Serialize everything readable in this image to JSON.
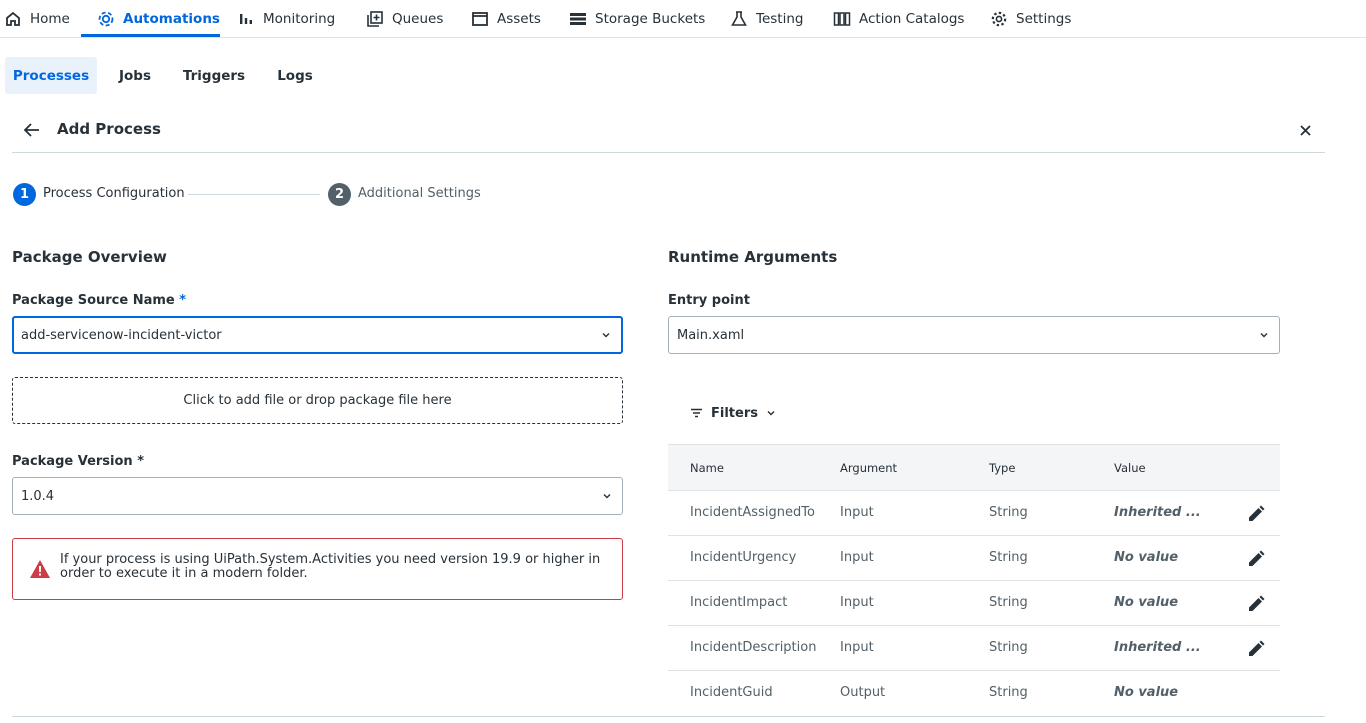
{
  "nav": {
    "items": [
      {
        "label": "Home",
        "icon": "home-icon"
      },
      {
        "label": "Automations",
        "icon": "automations-icon",
        "active": true
      },
      {
        "label": "Monitoring",
        "icon": "monitoring-icon"
      },
      {
        "label": "Queues",
        "icon": "queues-icon"
      },
      {
        "label": "Assets",
        "icon": "assets-icon"
      },
      {
        "label": "Storage Buckets",
        "icon": "storage-buckets-icon"
      },
      {
        "label": "Testing",
        "icon": "testing-icon"
      },
      {
        "label": "Action Catalogs",
        "icon": "action-catalogs-icon"
      },
      {
        "label": "Settings",
        "icon": "settings-icon"
      }
    ]
  },
  "subtabs": [
    {
      "label": "Processes",
      "active": true
    },
    {
      "label": "Jobs"
    },
    {
      "label": "Triggers"
    },
    {
      "label": "Logs"
    }
  ],
  "header": {
    "title": "Add Process"
  },
  "stepper": {
    "step1": {
      "number": "1",
      "label": "Process Configuration"
    },
    "step2": {
      "number": "2",
      "label": "Additional Settings"
    }
  },
  "package": {
    "section_title": "Package Overview",
    "source_label": "Package Source Name",
    "required_mark": "*",
    "source_value": "add-servicenow-incident-victor",
    "dropzone_text": "Click to add file or drop package file here",
    "version_label": "Package Version *",
    "version_value": "1.0.4",
    "alert_text": "If your process is using UiPath.System.Activities you need version 19.9 or higher in order to execute it in a modern folder."
  },
  "runtime": {
    "section_title": "Runtime Arguments",
    "entry_label": "Entry point",
    "entry_value": "Main.xaml",
    "filters_label": "Filters",
    "columns": {
      "name": "Name",
      "argument": "Argument",
      "type": "Type",
      "value": "Value"
    },
    "rows": [
      {
        "name": "IncidentAssignedTo",
        "argument": "Input",
        "type": "String",
        "value": "Inherited ..."
      },
      {
        "name": "IncidentUrgency",
        "argument": "Input",
        "type": "String",
        "value": "No value"
      },
      {
        "name": "IncidentImpact",
        "argument": "Input",
        "type": "String",
        "value": "No value"
      },
      {
        "name": "IncidentDescription",
        "argument": "Input",
        "type": "String",
        "value": "Inherited ..."
      },
      {
        "name": "IncidentGuid",
        "argument": "Output",
        "type": "String",
        "value": "No value"
      }
    ]
  },
  "colors": {
    "accent": "#0067df",
    "error": "#cc3d45",
    "step_inactive": "#526069"
  }
}
